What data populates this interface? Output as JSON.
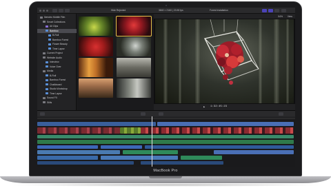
{
  "device": {
    "brand_label": "MacBook Pro"
  },
  "colors": {
    "accent": "#4b43b8",
    "video_clip": "#4a6fb5",
    "audio_clip": "#2f8a5a",
    "title_clip": "#7a4ec2",
    "connected_clip": "#3d67b8"
  },
  "toolbar": {
    "browser_filter": "Hide Rejected",
    "viewer_format": "3840 × 2160 | 23.98 fps",
    "project_name": "Forest Installation",
    "zoom": "54%",
    "view_label": "View"
  },
  "library": {
    "items": [
      {
        "label": "Ikenobo Mobile Film",
        "icon": "library-icon"
      },
      {
        "label": "Smart Collections",
        "icon": "folder-icon"
      },
      {
        "label": "All Clips",
        "icon": "star-icon"
      },
      {
        "label": "Bamboo",
        "icon": "keyword-icon"
      },
      {
        "label": "B-Roll",
        "icon": "keyword-icon"
      },
      {
        "label": "Bamboo Forest",
        "icon": "keyword-icon"
      },
      {
        "label": "Flower Beauty",
        "icon": "keyword-icon"
      },
      {
        "label": "Time Lapse",
        "icon": "keyword-icon"
      },
      {
        "label": "Current Project",
        "icon": "event-icon"
      },
      {
        "label": "Website Audio",
        "icon": "event-icon"
      },
      {
        "label": "Interview",
        "icon": "keyword-icon"
      },
      {
        "label": "Voice Over",
        "icon": "keyword-icon"
      },
      {
        "label": "Media",
        "icon": "event-icon"
      },
      {
        "label": "B-Roll",
        "icon": "keyword-icon"
      },
      {
        "label": "Bamboo Forest",
        "icon": "keyword-icon"
      },
      {
        "label": "Chalkboard",
        "icon": "keyword-icon"
      },
      {
        "label": "Studio Workshop",
        "icon": "keyword-icon"
      },
      {
        "label": "Time Lapse",
        "icon": "keyword-icon"
      },
      {
        "label": "Sound FX",
        "icon": "event-icon"
      },
      {
        "label": "Stills",
        "icon": "event-icon"
      }
    ]
  },
  "viewer": {
    "timecode": "1:32:45:23"
  }
}
